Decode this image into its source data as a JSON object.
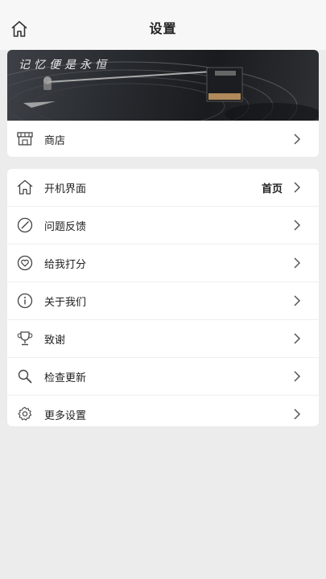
{
  "header": {
    "title": "设置"
  },
  "banner": {
    "text": "记忆便是永恒"
  },
  "store": {
    "label": "商店"
  },
  "menu": [
    {
      "label": "开机界面",
      "value": "首页"
    },
    {
      "label": "问题反馈"
    },
    {
      "label": "给我打分"
    },
    {
      "label": "关于我们"
    },
    {
      "label": "致谢"
    },
    {
      "label": "检查更新"
    },
    {
      "label": "更多设置"
    }
  ]
}
